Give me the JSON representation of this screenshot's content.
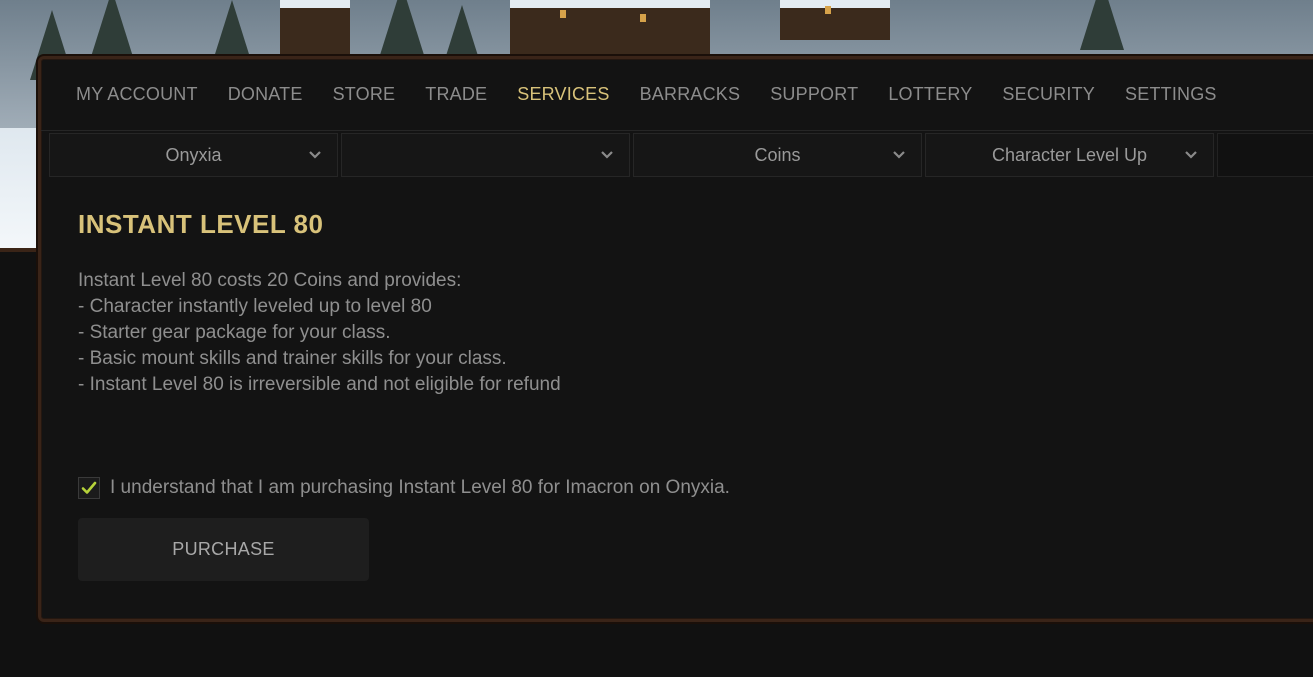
{
  "nav": {
    "items": [
      {
        "label": "MY ACCOUNT"
      },
      {
        "label": "DONATE"
      },
      {
        "label": "STORE"
      },
      {
        "label": "TRADE"
      },
      {
        "label": "SERVICES",
        "active": true
      },
      {
        "label": "BARRACKS"
      },
      {
        "label": "SUPPORT"
      },
      {
        "label": "LOTTERY"
      },
      {
        "label": "SECURITY"
      },
      {
        "label": "SETTINGS"
      }
    ]
  },
  "selects": {
    "realm": "Onyxia",
    "character": "",
    "currency": "Coins",
    "service": "Character Level Up"
  },
  "service": {
    "title": "INSTANT LEVEL 80",
    "description_lines": [
      "Instant Level 80 costs 20 Coins and provides:",
      "- Character instantly leveled up to level 80",
      "- Starter gear package for your class.",
      "- Basic mount skills and trainer skills for your class.",
      "- Instant Level 80 is irreversible and not eligible for refund"
    ],
    "confirm_text": "I understand that I am purchasing Instant Level 80 for Imacron on Onyxia.",
    "confirm_checked": true,
    "purchase_label": "PURCHASE"
  },
  "colors": {
    "accent": "#d8c27a",
    "text_muted": "#8f8f8f",
    "check": "#b6d23a",
    "border_wood": "#3a2418"
  }
}
